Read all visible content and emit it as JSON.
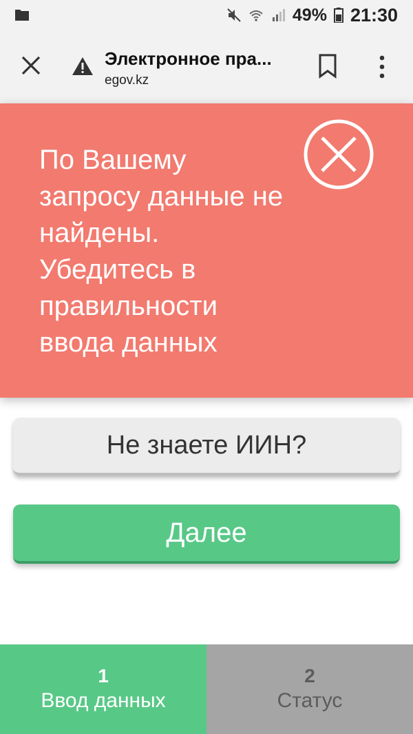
{
  "status_bar": {
    "battery_percent": "49%",
    "time": "21:30",
    "icons": [
      "folder-icon",
      "mute-icon",
      "wifi-icon",
      "signal-icon",
      "battery-icon"
    ]
  },
  "browser": {
    "title": "Электронное пра...",
    "domain": "egov.kz",
    "icons": [
      "close-icon",
      "warning-icon",
      "bookmark-icon",
      "more-vert-icon"
    ]
  },
  "error": {
    "message": "По Вашему запросу данные не найдены. Убедитесь в правильности ввода данных",
    "icon": "error-circle-x-icon"
  },
  "buttons": {
    "iin_label": "Не знаете ИИН?",
    "next_label": "Далее"
  },
  "steps": [
    {
      "number": "1",
      "label": "Ввод данных"
    },
    {
      "number": "2",
      "label": "Статус"
    }
  ],
  "colors": {
    "error_bg": "#f27a6f",
    "primary_green": "#58c887",
    "inactive_step": "#a5a5a5",
    "secondary_button": "#ececec"
  }
}
